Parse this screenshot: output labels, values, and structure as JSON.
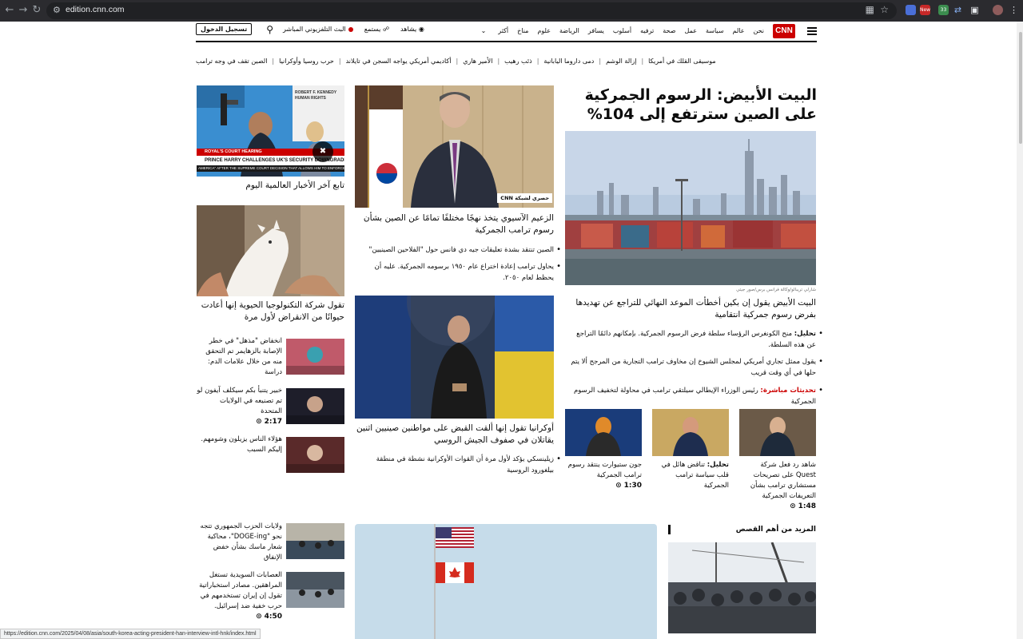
{
  "browser": {
    "url": "edition.cnn.com",
    "status_url": "https://edition.cnn.com/2025/04/08/asia/south-korea-acting-president-han-interview-intl-hnk/index.html",
    "ext_badge_new": "New",
    "ext_badge_count": "33"
  },
  "nav": {
    "logo": "CNN",
    "links": [
      "نحن",
      "عالم",
      "سياسة",
      "عمل",
      "صحة",
      "ترفيه",
      "أسلوب",
      "يسافر",
      "الرياضة",
      "علوم",
      "مناخ",
      "أكثر"
    ],
    "watch": "يشاهد",
    "listen": "يستمع",
    "live_tv": "البث التلفزيوني المباشر",
    "login": "تسجيل الدخول"
  },
  "trending": [
    "الصين تقف في وجه ترامب",
    "حرب روسيا وأوكرانيا",
    "أكاديمي أمريكي يواجه السجن في تايلاند",
    "الأمير هاري",
    "ذئب رهيب",
    "دمى داروما اليابانية",
    "إزالة الوشم",
    "موسيقى القلك في أمريكا"
  ],
  "lead": {
    "headline": "البيت الأبيض: الرسوم الجمركية على الصين سترتفع إلى 104%",
    "credit": "شارلي تريبالو/وكالة فرانس برس/صور جيتي",
    "subhead": "البيت الأبيض يقول إن بكين أخطأت الموعد النهائي للتراجع عن تهديدها بفرض رسوم جمركية انتقامية",
    "bullets": [
      {
        "prefix": "تحليل:",
        "text": "منح الكونغرس الرؤساء سلطة فرض الرسوم الجمركية. بإمكانهم دائمًا التراجع عن هذه السلطة."
      },
      {
        "prefix": "",
        "text": "يقول ممثل تجاري أمريكي لمجلس الشيوخ إن مخاوف ترامب التجارية من المرجح ألا يتم حلها في أي وقت قريب"
      },
      {
        "prefix": "تحديثات مباشرة:",
        "text": "رئيس الوزراء الإيطالي سيلتقي ترامب في محاولة لتخفيف الرسوم الجمركية"
      }
    ],
    "cards": [
      {
        "prefix": "",
        "text": "شاهد رد فعل شركة Quest على تصريحات مستشاري ترامب بشأن التعريفات الجمركية",
        "duration": "1:48"
      },
      {
        "prefix": "تحليل:",
        "text": "تناقض هائل في قلب سياسة ترامب الجمركية",
        "duration": ""
      },
      {
        "prefix": "",
        "text": "جون ستيوارت ينتقد رسوم ترامب الجمركية",
        "duration": "1:30"
      }
    ]
  },
  "middle": {
    "story1": {
      "badge": "حصري لشبكة CNN",
      "headline": "الزعيم الآسيوي يتخذ نهجًا مختلفًا تمامًا عن الصين بشأن رسوم ترامب الجمركية",
      "bullets": [
        "الصين تنتقد بشدة تعليقات جيه دي فانس حول \"الفلاحين الصينيين\"",
        "يحاول ترامب إعادة اختراع عام ١٩٥٠ برسومه الجمركية. عليه أن يحظط لعام ٢٠٥٠."
      ]
    },
    "story2": {
      "headline": "أوكرانيا تقول إنها ألقت القبض على مواطنين صينيين اثنين يقاتلان في صفوف الجيش الروسي",
      "bullets": [
        "زيلينسكي يؤكد لأول مرة أن القوات الأوكرانية نشطة في منطقة بيلغورود الروسية"
      ]
    }
  },
  "right": {
    "video": {
      "chyron_top": "ROYAL'S COURT HEARING",
      "chyron": "PRINCE HARRY CHALLENGES UK'S SECURITY DOWNGRADE",
      "ticker": "AMERICA\" AFTER THE SUPREME COURT DECISION THAT ALLOWS HIM TO ENFORCE",
      "sign": "ROBERT F. KENNEDY HUMAN RIGHTS",
      "caption": "تابع آخر الأخبار العالمية اليوم"
    },
    "story": "تقول شركة التكنولوجيا الحيوية إنها أعادت حيوانًا من الانقراض لأول مرة",
    "items": [
      {
        "text": "انخفاض \"مذهل\" في خطر الإصابة بالزهايمر تم التحقق منه من خلال علامات الدم: دراسة",
        "duration": ""
      },
      {
        "text": "خبير يتنبأ بكم سيكلف آيفون لو تم تصنيعه في الولايات المتحدة",
        "duration": "2:17"
      },
      {
        "text": "هؤلاء الناس يزيلون وشومهم. إليكم السبب",
        "duration": ""
      }
    ]
  },
  "lower": {
    "more_title": "المزيد من أهم القصص",
    "items": [
      {
        "text": "ولايات الحزب الجمهوري تتجه نحو \"DOGE-ing\"، محاكية شعار ماسك بشأن خفض الإنفاق",
        "duration": ""
      },
      {
        "text": "العصابات السويدية تستغل المراهقين. مصادر استخباراتية تقول إن إيران تستخدمهم في حرب خفية ضد إسرائيل.",
        "duration": "4:50"
      }
    ]
  },
  "colors": {
    "cnn_red": "#cc0000",
    "chrome_dark": "#2b2b2f"
  }
}
